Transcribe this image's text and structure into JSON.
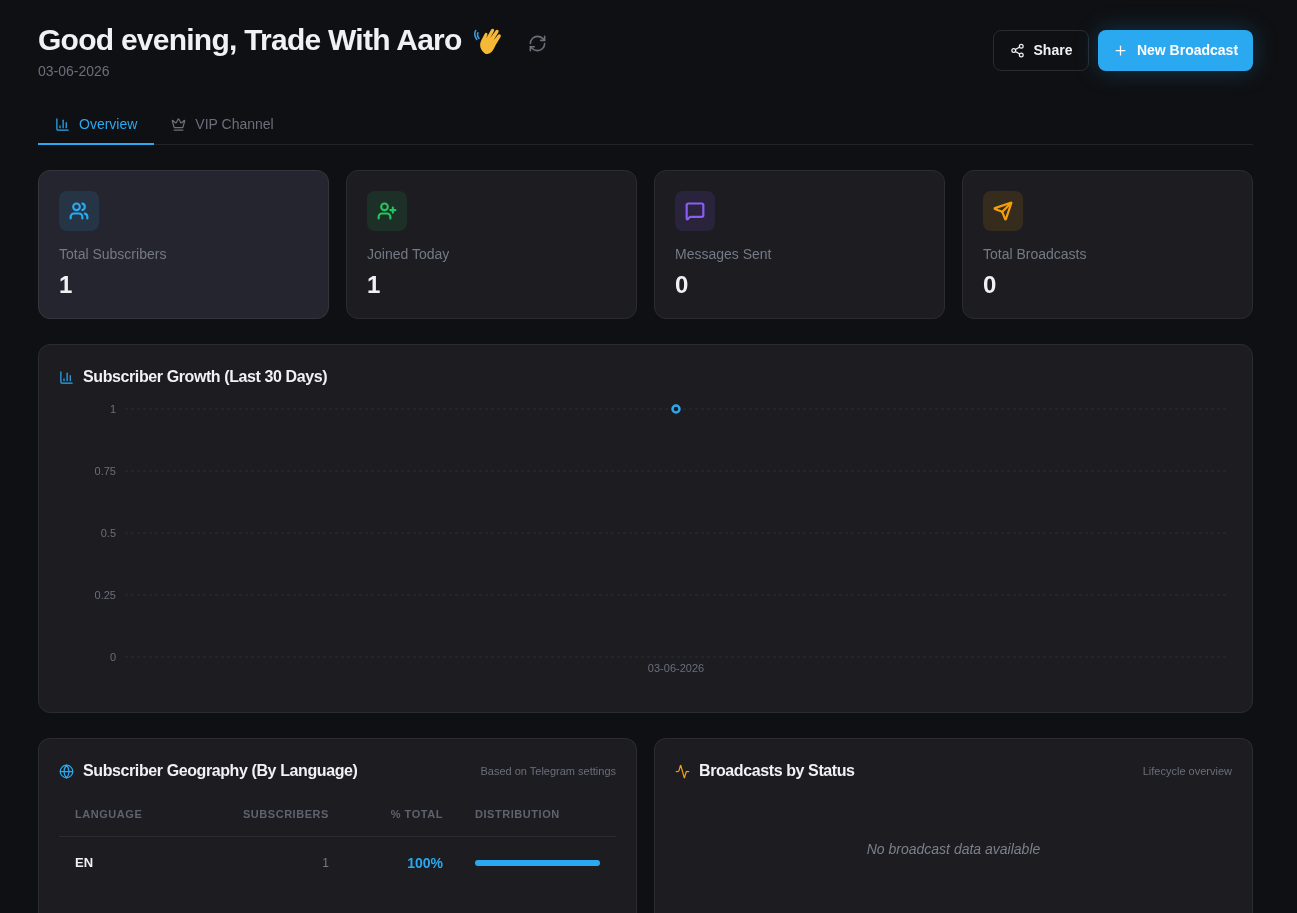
{
  "header": {
    "greeting": "Good evening, Trade With Aaro",
    "date": "03-06-2026",
    "actions": [
      {
        "kind": "outline",
        "label": "Share"
      },
      {
        "kind": "primary",
        "label": "New Broadcast"
      }
    ]
  },
  "tabs": [
    {
      "label": "Overview",
      "selected": true
    },
    {
      "label": "VIP Channel",
      "selected": false
    }
  ],
  "stats": [
    {
      "label": "Total Subscribers",
      "value": "1",
      "color": "#2aa8f0",
      "hovered": true
    },
    {
      "label": "Joined Today",
      "value": "1",
      "color": "#22c55e",
      "hovered": false
    },
    {
      "label": "Messages Sent",
      "value": "0",
      "color": "#8b5cf6",
      "hovered": false
    },
    {
      "label": "Total Broadcasts",
      "value": "0",
      "color": "#f59e0b",
      "hovered": false
    }
  ],
  "growth": {
    "title": "Subscriber Growth (Last 30 Days)",
    "chart_data": {
      "type": "line",
      "categories": [
        "03-06-2026"
      ],
      "series": [
        {
          "color": "#2aa8f0",
          "values": [
            1
          ],
          "marker": true
        }
      ],
      "ylim": [
        0,
        1
      ],
      "yticks": [
        0,
        0.25,
        0.5,
        0.75,
        1
      ],
      "grid": true
    }
  },
  "geography": {
    "title": "Subscriber Geography (By Language)",
    "note": "Based on Telegram settings",
    "table": {
      "columns": [
        "LANGUAGE",
        "SUBSCRIBERS",
        "% TOTAL",
        "DISTRIBUTION"
      ],
      "rows": [
        {
          "language": "EN",
          "subscribers": "1",
          "percent": "100%",
          "level": 1
        }
      ]
    }
  },
  "broadcasts": {
    "title": "Broadcasts by Status",
    "note": "Lifecycle overview",
    "empty_message": "No broadcast data available"
  }
}
